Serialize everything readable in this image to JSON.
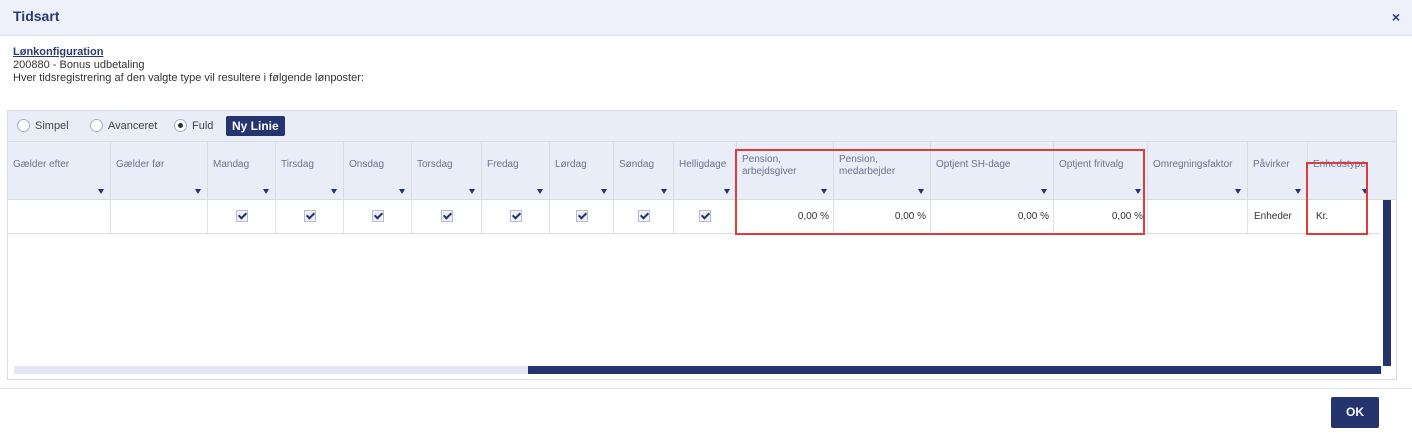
{
  "dialog": {
    "title": "Tidsart",
    "close_glyph": "×",
    "close_icon": "close-icon"
  },
  "info": {
    "config_link": "Lønkonfiguration",
    "code_line": "200880 - Bonus udbetaling",
    "description": "Hver tidsregistrering af den valgte type vil resultere i følgende lønposter:"
  },
  "mode": {
    "options": [
      "Simpel",
      "Avanceret",
      "Fuld"
    ],
    "selected": "Fuld"
  },
  "toolbar": {
    "new_line_label": "Ny Linie"
  },
  "table": {
    "columns": [
      "Gælder efter",
      "Gælder før",
      "Mandag",
      "Tirsdag",
      "Onsdag",
      "Torsdag",
      "Fredag",
      "Lørdag",
      "Søndag",
      "Helligdage",
      "Pension, arbejdsgiver",
      "Pension, medarbejder",
      "Optjent SH-dage",
      "Optjent fritvalg",
      "Omregningsfaktor",
      "Påvirker",
      "Enhedstype"
    ],
    "row": {
      "gaelder_efter": "",
      "gaelder_foer": "",
      "mandag": true,
      "tirsdag": true,
      "onsdag": true,
      "torsdag": true,
      "fredag": true,
      "loerdag": true,
      "soendag": true,
      "helligdage": true,
      "pension_arbejdsgiver": "0,00 %",
      "pension_medarbejder": "0,00 %",
      "optjent_sh_dage": "0,00 %",
      "optjent_fritvalg": "0,00 %",
      "omregningsfaktor": "",
      "paavirker": "Enheder",
      "enhedstype": "Kr."
    }
  },
  "footer": {
    "ok_label": "OK"
  },
  "colors": {
    "accent": "#25336e",
    "highlight": "#e03a3a",
    "header_bg": "#e9edf7"
  }
}
